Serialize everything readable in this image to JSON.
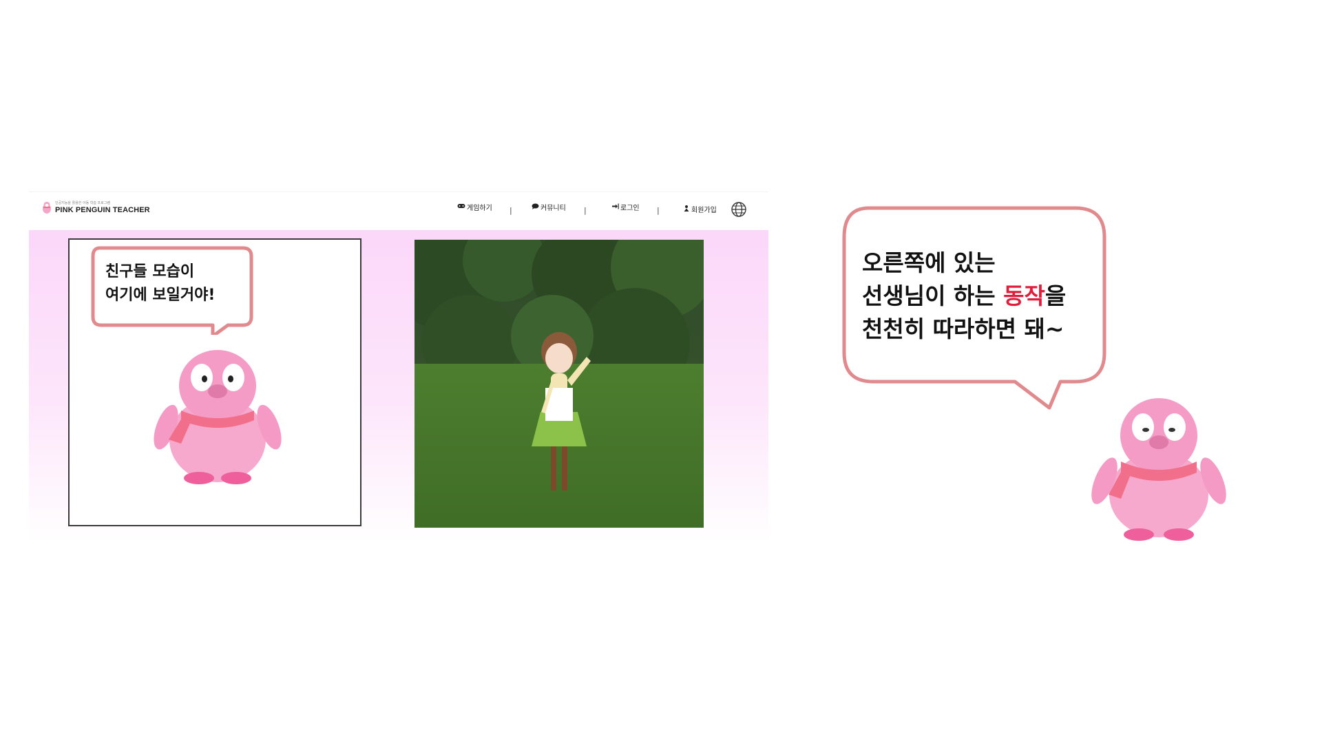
{
  "header": {
    "brand_sub": "인공지능을 활용한 아동 학습 프로그램",
    "brand_name": "PINK PENGUIN TEACHER",
    "nav": [
      {
        "icon": "gamepad-icon",
        "label": "게임하기"
      },
      {
        "icon": "chat-icon",
        "label": "커뮤니티"
      },
      {
        "icon": "login-icon",
        "label": "로그인"
      },
      {
        "icon": "user-plus-icon",
        "label": "회원가입"
      }
    ],
    "separator": "|",
    "language_icon": "globe-icon"
  },
  "student_panel": {
    "bubble_text": "친구들 모습이\n여기에 보일거야!"
  },
  "guide_bubble": {
    "line1": "오른쪽에 있는",
    "line2_prefix": "선생님이 하는 ",
    "line2_highlight": "동작",
    "line2_suffix": "을",
    "line3": "천천히 따라하면 돼~"
  },
  "colors": {
    "bubble_border": "#e08a8e",
    "highlight": "#e01e3c",
    "panel_gradient_top": "#fbd7fa",
    "penguin_pink": "#f6a3cb",
    "scarf": "#f26f8b"
  }
}
